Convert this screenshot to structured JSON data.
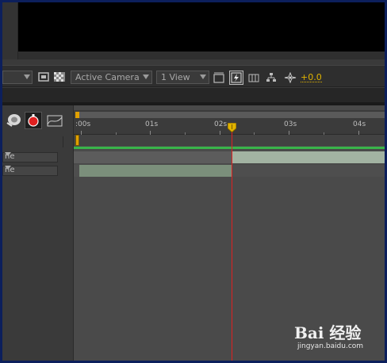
{
  "viewer_toolbar": {
    "camera_label": "Active Camera",
    "view_label": "1 View",
    "exposure_value": "+0.0"
  },
  "timeline": {
    "ticks": [
      ":00s",
      "01s",
      "02s",
      "03s",
      "04s"
    ],
    "layers": [
      {
        "name": "ne",
        "mode": "dropdown"
      },
      {
        "name": "ne",
        "mode": "dropdown"
      }
    ],
    "current_time_fraction": 0.5
  },
  "colors": {
    "accent_yellow": "#e0b300",
    "cti_red": "#e02020",
    "cache_green": "#39b54a",
    "frame_blue": "#0c1f5c"
  },
  "icons": [
    "dropdown-arrow-icon",
    "checkerboard-icon",
    "region-of-interest-icon",
    "fast-preview-icon",
    "flowchart-icon",
    "exposure-icon",
    "stopwatch-icon",
    "motion-blur-icon",
    "graph-editor-icon",
    "time-marker-icon"
  ],
  "watermark": {
    "logo": "Bai 经验",
    "url": "jingyan.baidu.com"
  }
}
